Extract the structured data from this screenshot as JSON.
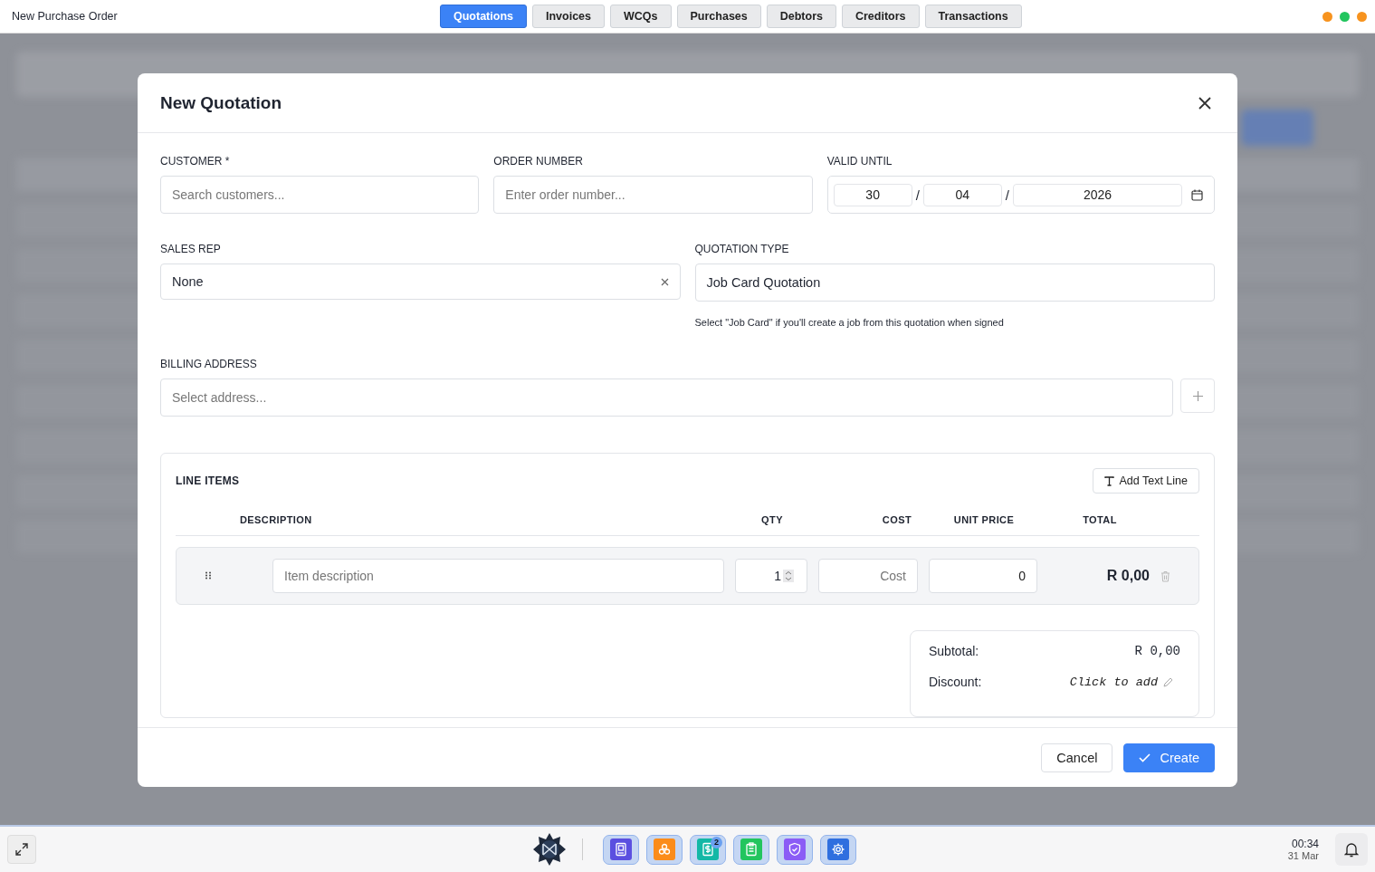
{
  "window": {
    "title": "New Purchase Order",
    "lights": [
      {
        "color": "#f7931e"
      },
      {
        "color": "#22c55e"
      },
      {
        "color": "#f7931e"
      }
    ]
  },
  "tabs": [
    {
      "label": "Quotations",
      "selected": true
    },
    {
      "label": "Invoices",
      "selected": false
    },
    {
      "label": "WCQs",
      "selected": false
    },
    {
      "label": "Purchases",
      "selected": false
    },
    {
      "label": "Debtors",
      "selected": false
    },
    {
      "label": "Creditors",
      "selected": false
    },
    {
      "label": "Transactions",
      "selected": false
    }
  ],
  "modal": {
    "title": "New Quotation",
    "customer": {
      "label": "CUSTOMER *",
      "placeholder": "Search customers..."
    },
    "order_number": {
      "label": "ORDER NUMBER",
      "placeholder": "Enter order number..."
    },
    "valid_until": {
      "label": "VALID UNTIL",
      "day": "30",
      "month": "04",
      "year": "2026",
      "separators": [
        "/",
        "/"
      ]
    },
    "sales_rep": {
      "label": "SALES REP",
      "value": "None"
    },
    "quotation_type": {
      "label": "QUOTATION TYPE",
      "value": "Job Card Quotation",
      "hint": "Select \"Job Card\" if you'll create a job from this quotation when signed"
    },
    "billing_address": {
      "label": "BILLING ADDRESS",
      "placeholder": "Select address..."
    },
    "line_items": {
      "title": "LINE ITEMS",
      "add_button": "Add Text Line",
      "columns": [
        "DESCRIPTION",
        "QTY",
        "COST",
        "UNIT PRICE",
        "TOTAL"
      ],
      "rows": [
        {
          "description_placeholder": "Item description",
          "qty": "1",
          "cost_placeholder": "Cost",
          "unit_price": "0",
          "total": "R 0,00"
        }
      ]
    },
    "totals": [
      {
        "kind": "amount",
        "label": "Subtotal:",
        "value": "R 0,00"
      },
      {
        "kind": "editable",
        "label": "Discount:",
        "value": "Click to add"
      }
    ],
    "buttons": [
      {
        "kind": "secondary",
        "label": "Cancel"
      },
      {
        "kind": "primary",
        "label": "Create"
      }
    ]
  },
  "taskbar": {
    "apps": [
      {
        "kind": "book",
        "color": "#5b4fe0"
      },
      {
        "kind": "boxes",
        "color": "#fb8c1a"
      },
      {
        "kind": "invoice",
        "color": "#14b8a6",
        "badge": "2"
      },
      {
        "kind": "clipboard",
        "color": "#22c55e"
      },
      {
        "kind": "shield",
        "color": "#8b5cf6"
      },
      {
        "kind": "gear",
        "color": "#2f6fdf"
      }
    ],
    "time": "00:34",
    "date": "31 Mar"
  }
}
